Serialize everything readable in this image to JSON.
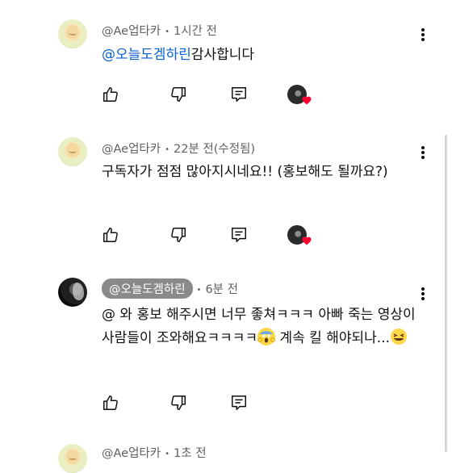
{
  "comments": [
    {
      "author": "@Ae업타카",
      "time": "1시간 전",
      "mention": "@오늘도겜하린",
      "text": "감사합니다"
    },
    {
      "author": "@Ae업타카",
      "time": "22분 전(수정됨)",
      "text": "구독자가 점점 많아지시네요!! (홍보해도 될까요?)"
    },
    {
      "author": "@오늘도겜하린",
      "time": "6분 전",
      "text_a": "@ 와 홍보 해주시면 너무 좋쳐ㅋㅋㅋ 아빠 죽는 영상이 사람들이 조와해요ㅋㅋㅋㅋ",
      "text_b": " 계속 킬 해야되나...",
      "emoji_a": "scream-emoji",
      "emoji_b": "laughing-emoji"
    },
    {
      "author": "@Ae업타카",
      "time": "1초 전"
    }
  ],
  "icons": {
    "like": "thumbs-up-icon",
    "dislike": "thumbs-down-icon",
    "reply": "reply-icon",
    "more": "more-vert-icon",
    "heart": "creator-heart-icon"
  },
  "colors": {
    "mention": "#065fd4",
    "heart": "#ff0033",
    "chip": "#8a8a8a"
  }
}
